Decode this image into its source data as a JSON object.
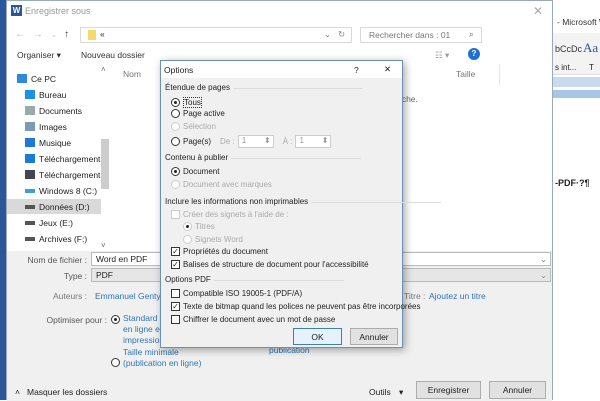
{
  "word_bg": {
    "title_fragment": "- Microsoft W",
    "styles": [
      "bCcDc",
      "Aa"
    ],
    "style_label": "s int...",
    "style_label2": "T",
    "doc_text": "-PDF·?¶"
  },
  "save_dialog": {
    "title": "Enregistrer sous",
    "app_icon": "W",
    "address": "«",
    "search_placeholder": "Rechercher dans : 01",
    "toolbar": {
      "organize": "Organiser ▾",
      "new_folder": "Nouveau dossier"
    },
    "columns": {
      "name": "Nom",
      "size": "Taille"
    },
    "empty_message_fragment": "rche.",
    "nav": [
      {
        "label": "Ce PC",
        "icon": "computer-icon",
        "color": "#2e8ad8"
      },
      {
        "label": "Bureau",
        "icon": "desktop-icon",
        "color": "#1e90e8"
      },
      {
        "label": "Documents",
        "icon": "documents-icon",
        "color": "#9aa"
      },
      {
        "label": "Images",
        "icon": "images-icon",
        "color": "#7a9ab5"
      },
      {
        "label": "Musique",
        "icon": "music-icon",
        "color": "#1e7ad8"
      },
      {
        "label": "Téléchargement",
        "icon": "download-icon",
        "color": "#1e7ad8"
      },
      {
        "label": "Téléchargement",
        "icon": "video-icon",
        "color": "#445"
      },
      {
        "label": "Windows 8 (C:)",
        "icon": "drive-icon",
        "color": "#3aa0d8"
      },
      {
        "label": "Données (D:)",
        "icon": "drive-icon",
        "color": "#555",
        "selected": true
      },
      {
        "label": "Jeux (E:)",
        "icon": "drive-icon",
        "color": "#555"
      },
      {
        "label": "Archives (F:)",
        "icon": "drive-icon",
        "color": "#555"
      }
    ],
    "filename_label": "Nom de fichier :",
    "filename": "Word en PDF",
    "type_label": "Type :",
    "type": "PDF",
    "authors_label": "Auteurs :",
    "authors": "Emmanuel Genty",
    "title_label": "Titre :",
    "title_value": "Ajoutez un titre",
    "optimize_label": "Optimiser pour :",
    "optimize_standard": "Standard (pu\nen ligne et\nimpression)",
    "optimize_min": "Taille minimale\n(publication en ligne)",
    "hidden_fragment": "publication",
    "hide_folders": "Masquer les dossiers",
    "tools": "Outils",
    "save": "Enregistrer",
    "cancel": "Annuler"
  },
  "options": {
    "title": "Options",
    "help": "?",
    "close": "✕",
    "page_range": {
      "heading": "Étendue de pages",
      "all": "Tous",
      "current": "Page active",
      "selection": "Sélection",
      "pages": "Page(s)",
      "from_label": "De :",
      "from": "1",
      "to_label": "À :",
      "to": "1"
    },
    "publish": {
      "heading": "Contenu à publier",
      "document": "Document",
      "markup": "Document avec marques"
    },
    "nonprint": {
      "heading": "Inclure les informations non imprimables",
      "bookmarks": "Créer des signets à l'aide de :",
      "headings": "Titres",
      "word_bookmarks": "Signets Word",
      "properties": "Propriétés du document",
      "tags": "Balises de structure de document pour l'accessibilité"
    },
    "pdf": {
      "heading": "Options PDF",
      "iso": "Compatible ISO 19005-1 (PDF/A)",
      "bitmap": "Texte de bitmap quand les polices ne peuvent pas être incorporées",
      "encrypt": "Chiffrer le document avec un mot de passe"
    },
    "ok": "OK",
    "cancel": "Annuler"
  }
}
